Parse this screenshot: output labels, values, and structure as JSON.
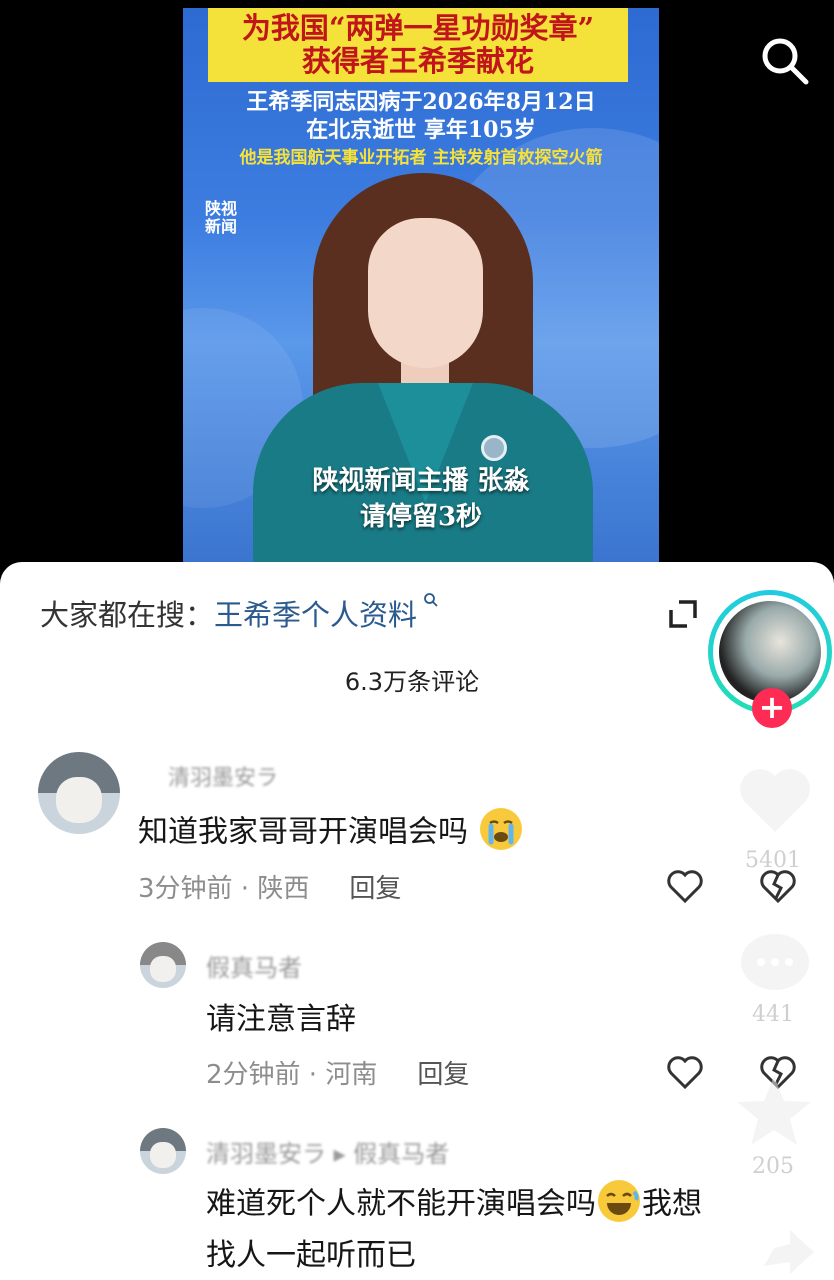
{
  "video": {
    "title_lines": [
      "为我国“两弹一星功勋奖章”",
      "获得者王希季献花"
    ],
    "subtitle_lines": [
      "王希季同志因病于2026年8月12日",
      "在北京逝世 享年105岁"
    ],
    "subtitle_yellow": "他是我国航天事业开拓者 主持发射首枚探空火箭",
    "channel_logo": [
      "陕视",
      "新闻"
    ],
    "caption_lines": [
      "陕视新闻主播 张淼",
      "请停留3秒"
    ]
  },
  "panel": {
    "hot_search_prefix": "大家都在搜：",
    "hot_search_keyword": "王希季个人资料",
    "comment_count": "6.3万条评论"
  },
  "comments": [
    {
      "username": "清羽墨安ラ",
      "text": "知道我家哥哥开演唱会吗",
      "time": "3分钟前",
      "location": "陕西",
      "reply_label": "回复"
    },
    {
      "username": "假真马者",
      "text": "请注意言辞",
      "time": "2分钟前",
      "location": "河南",
      "reply_label": "回复"
    },
    {
      "username": "清羽墨安ラ ▸ 假真马者",
      "text_line1": "难道死个人就不能开演唱会吗",
      "text_line1_tail": "我想",
      "text_line2": "找人一起听而已"
    }
  ],
  "rail": {
    "like_count": "5401",
    "comment_count": "441",
    "favorite_count": "205"
  },
  "icons": [
    "search-icon",
    "expand-icon",
    "heart-icon",
    "dislike-icon",
    "crying-emoji-icon",
    "laughing-emoji-icon",
    "star-icon",
    "comment-bubble-icon",
    "share-icon"
  ],
  "colors": {
    "title_box": "#f4e23a",
    "title_text": "#c0161b",
    "keyword": "#2a5a8e",
    "follow_button": "#fe2c55",
    "avatar_ring": "#22c9e5"
  }
}
